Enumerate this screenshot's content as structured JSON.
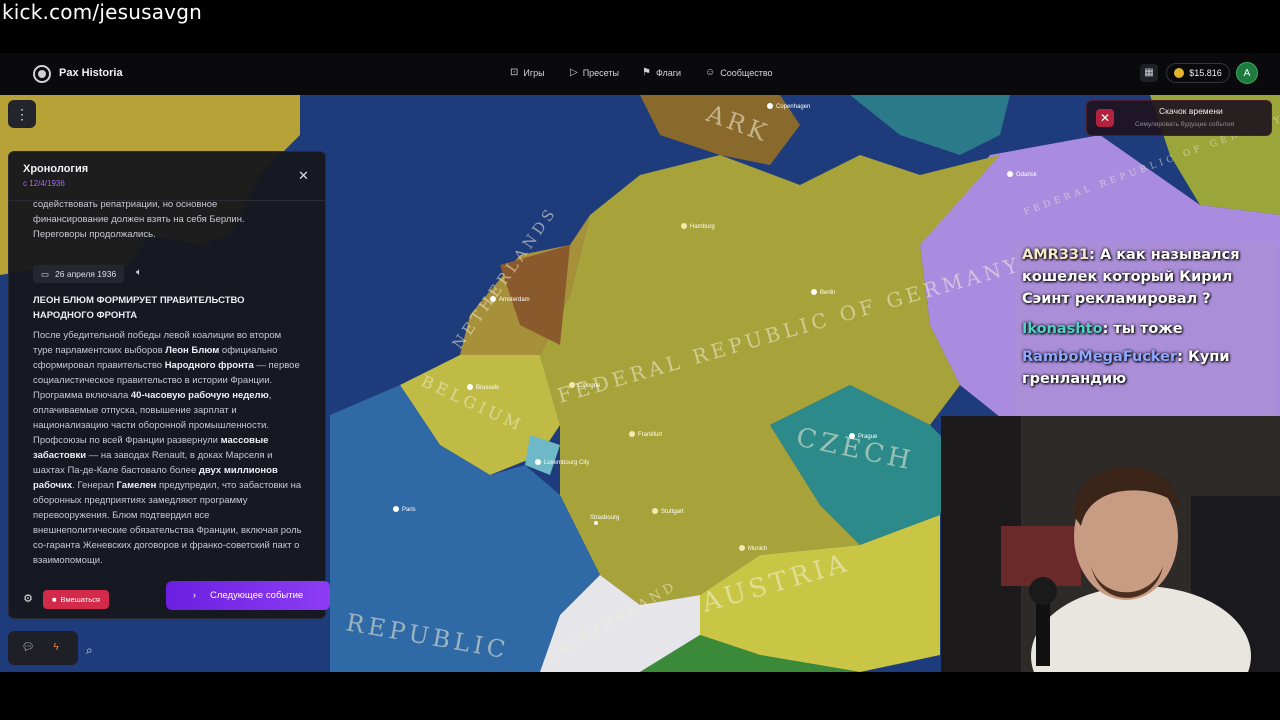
{
  "stream": {
    "url": "kick.com/jesusavgn"
  },
  "app": {
    "brand": "Pax Historia",
    "nav": [
      {
        "icon": "gamepad-icon",
        "label": "Игры"
      },
      {
        "icon": "play-icon",
        "label": "Пресеты"
      },
      {
        "icon": "flag-icon",
        "label": "Флаги"
      },
      {
        "icon": "users-icon",
        "label": "Сообщество"
      }
    ],
    "balance": "$15.816",
    "avatar_letter": "A"
  },
  "map": {
    "labels": [
      "FEDERAL REPUBLIC OF GERMANY",
      "NETHERLANDS",
      "BELGIUM",
      "CZECH",
      "AUSTRIA",
      "SWITZERLAND",
      "REPUBLIC",
      "ARK",
      "FEDERAL REPUBLIC OF GERMANY"
    ],
    "cities": [
      "Copenhagen",
      "Hamburg",
      "Berlin",
      "Amsterdam",
      "Brussels",
      "Cologne",
      "Frankfurt",
      "Prague",
      "Stuttgart",
      "Munich",
      "Paris",
      "Luxembourg City",
      "Strasbourg",
      "Gdańsk"
    ]
  },
  "timeline": {
    "title": "Хронология",
    "since": "с 12/4/1936",
    "previous_text": "содействовать репатриации, но основное финансирование должен взять на себя Берлин. Переговоры продолжались.",
    "date": "26 апреля 1936",
    "event_title": "ЛЕОН БЛЮМ ФОРМИРУЕТ ПРАВИТЕЛЬСТВО НАРОДНОГО ФРОНТА",
    "event_body": [
      {
        "t": "После убедительной победы левой коалиции во втором туре парламентских выборов ",
        "b": false
      },
      {
        "t": "Леон Блюм",
        "b": true
      },
      {
        "t": " официально сформировал правительство ",
        "b": false
      },
      {
        "t": "Народного фронта",
        "b": true
      },
      {
        "t": " — первое социалистическое правительство в истории Франции. Программа включала ",
        "b": false
      },
      {
        "t": "40-часовую рабочую неделю",
        "b": true
      },
      {
        "t": ", оплачиваемые отпуска, повышение зарплат и национализацию части оборонной промышленности. Профсоюзы по всей Франции развернули ",
        "b": false
      },
      {
        "t": "массовые забастовки",
        "b": true
      },
      {
        "t": " — на заводах Renault, в доках Марселя и шахтах Па-де-Кале бастовало более ",
        "b": false
      },
      {
        "t": "двух миллионов рабочих",
        "b": true
      },
      {
        "t": ". Генерал ",
        "b": false
      },
      {
        "t": "Гамелен",
        "b": true
      },
      {
        "t": " предупредил, что забастовки на оборонных предприятиях замедляют программу перевооружения. Блюм подтвердил все внешнеполитические обязательства Франции, включая роль со-гаранта Женевских договоров и франко-советский пакт о взаимопомощи.",
        "b": false
      }
    ],
    "intervene_label": "Вмешаться",
    "next_label": "Следующее событие"
  },
  "time_jump": {
    "title": "Скачок времени",
    "subtitle": "Симулировать будущие события"
  },
  "chat": [
    {
      "user": "AMR331",
      "user_color": "#f3e9c6",
      "text": ": А как назывался кошелек который Кирил Сэинт рекламировал ?"
    },
    {
      "user": "Ikonashto",
      "user_color": "#4fd1c5",
      "text": ": ты тоже"
    },
    {
      "user": "RamboMegaFucker",
      "user_color": "#8fa7ff",
      "text": ": Купи гренландию"
    }
  ],
  "colors": {
    "accent": "#8e3cf4",
    "danger": "#d12a4a",
    "germany": "#a7a23a",
    "france": "#2f6aa6",
    "czech": "#2c8a8a",
    "poland": "#a98be0",
    "sea": "#1d3a7a"
  }
}
